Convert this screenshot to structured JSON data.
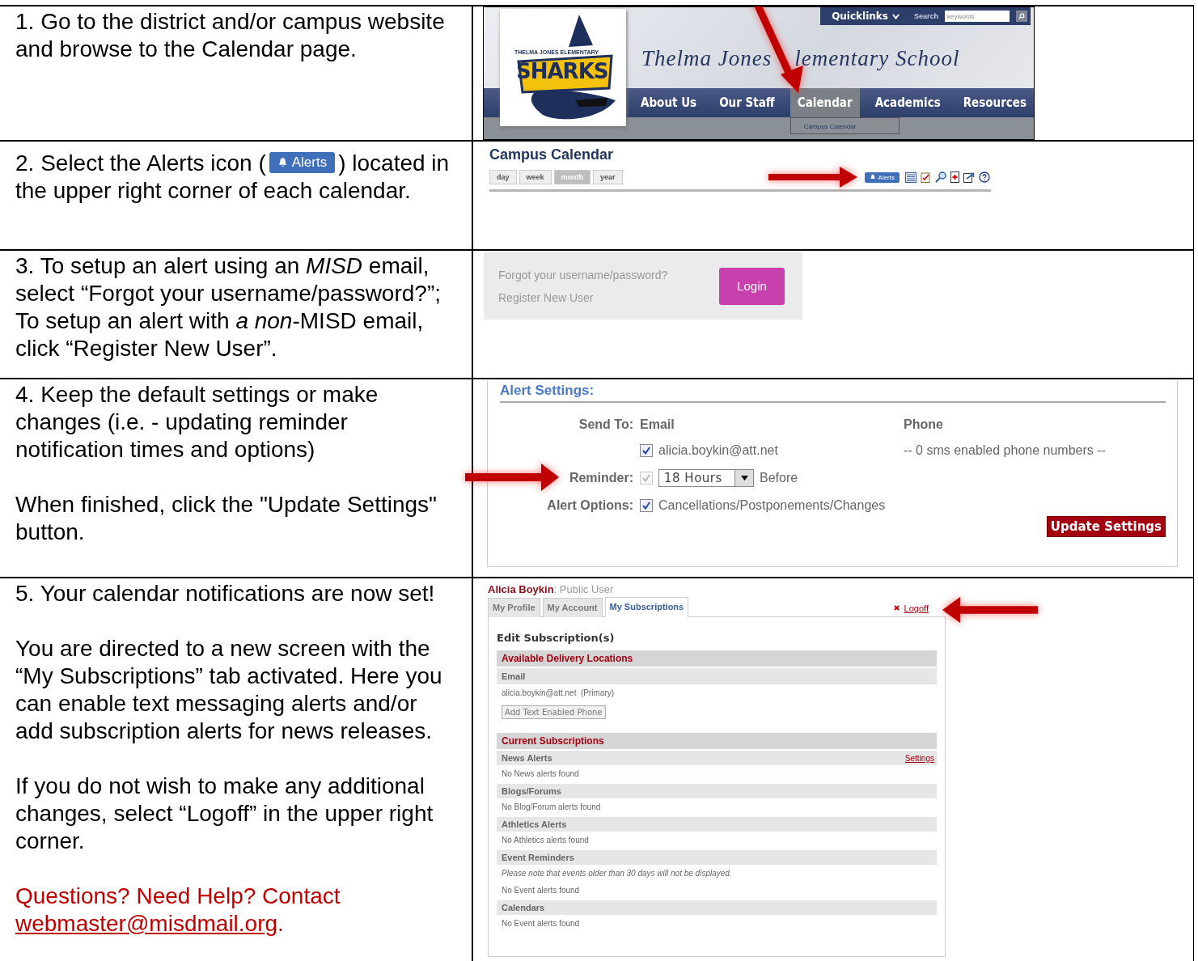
{
  "rows": [
    {
      "instructions": {
        "kind": "text",
        "paragraphs": [
          "1. Go to the district and/or campus website and browse to the Calendar page."
        ]
      },
      "screenshot": {
        "kind": "school_site",
        "logo": {
          "arc": "THELMA JONES ELEMENTARY",
          "name": "SHARKS"
        },
        "quicklinks": "Quicklinks",
        "search_label": "Search",
        "search_placeholder": "keywords",
        "title": [
          "Thelma Jones",
          "lementary School"
        ],
        "nav": [
          {
            "label": "About Us",
            "selected": false
          },
          {
            "label": "Our Staff",
            "selected": false
          },
          {
            "label": "Calendar",
            "selected": true
          },
          {
            "label": "Academics",
            "selected": false
          },
          {
            "label": "Resources",
            "selected": false
          }
        ],
        "dropdown": "Campus Calendar"
      }
    },
    {
      "instructions": {
        "kind": "badge",
        "before": "2. Select the Alerts icon (",
        "badge": "Alerts",
        "after": ") located in the upper right corner of each calendar."
      },
      "screenshot": {
        "kind": "calendar",
        "title": "Campus Calendar",
        "views": [
          {
            "label": "day",
            "selected": false
          },
          {
            "label": "week",
            "selected": false
          },
          {
            "label": "month",
            "selected": true
          },
          {
            "label": "year",
            "selected": false
          }
        ],
        "alerts": "Alerts"
      }
    },
    {
      "instructions": {
        "kind": "text",
        "paragraphs": [
          "3. To setup an alert using an *MISD* email, select “Forgot your username/password?”; To setup an alert with *a non*-MISD email, click “Register New User”."
        ]
      },
      "screenshot": {
        "kind": "login",
        "links": [
          "Forgot your username/password?",
          "Register New User"
        ],
        "button": "Login"
      }
    },
    {
      "instructions": {
        "kind": "text",
        "paragraphs": [
          "4. Keep the default settings or make changes (i.e. - updating reminder notification times and options)",
          "When finished, click the \"Update Settings\" button."
        ]
      },
      "screenshot": {
        "kind": "alert_settings",
        "title": "Alert Settings:",
        "send_to": "Send To:",
        "email_heading": "Email",
        "phone_heading": "Phone",
        "email": {
          "label": "alicia.boykin@att.net",
          "checked": true
        },
        "phone_note": "-- 0 sms enabled phone numbers --",
        "reminder_label": "Reminder:",
        "reminder": {
          "checked": true,
          "disabled": true,
          "value": "18 Hours",
          "suffix": "Before"
        },
        "options_label": "Alert Options:",
        "option": {
          "label": "Cancellations/Postponements/Changes",
          "checked": true
        },
        "button": "Update Settings"
      }
    },
    {
      "instructions": {
        "kind": "text",
        "paragraphs": [
          "5. Your calendar notifications are now set!",
          "You are directed to a new screen with the “My Subscriptions” tab activated. Here you can enable text messaging alerts and/or add subscription alerts for news releases.",
          "If you do not wish to make any additional changes, select “Logoff” in the upper right corner."
        ],
        "help": {
          "text": "Questions? Need Help? Contact",
          "link": "webmaster@misdmail.org",
          "after": "."
        }
      },
      "screenshot": {
        "kind": "subscriptions",
        "user": "Alicia Boykin",
        "role": ": Public User",
        "tabs": [
          {
            "label": "My Profile",
            "selected": false
          },
          {
            "label": "My Account",
            "selected": false
          },
          {
            "label": "My Subscriptions",
            "selected": true
          }
        ],
        "logoff": "Logoff",
        "heading": "Edit Subscription(s)",
        "delivery": {
          "title": "Available Delivery Locations",
          "subheader": "Email",
          "address": "alicia.boykin@att.net",
          "note": "(Primary)",
          "button": "Add Text Enabled Phone"
        },
        "current": {
          "title": "Current Subscriptions",
          "groups": [
            {
              "name": "News Alerts",
              "link": "Settings",
              "lines": [
                {
                  "kind": "plain",
                  "text": "No News alerts found"
                }
              ]
            },
            {
              "name": "Blogs/Forums",
              "lines": [
                {
                  "kind": "plain",
                  "text": "No Blog/Forum alerts found"
                }
              ]
            },
            {
              "name": "Athletics Alerts",
              "lines": [
                {
                  "kind": "plain",
                  "text": "No Athletics alerts found"
                }
              ]
            },
            {
              "name": "Event Reminders",
              "lines": [
                {
                  "kind": "note",
                  "text": "Please note that events older than 30 days will not be displayed."
                },
                {
                  "kind": "plain",
                  "text": "No Event alerts found"
                }
              ]
            },
            {
              "name": "Calendars",
              "lines": [
                {
                  "kind": "plain",
                  "text": "No Event alerts found"
                }
              ]
            }
          ]
        }
      }
    }
  ]
}
